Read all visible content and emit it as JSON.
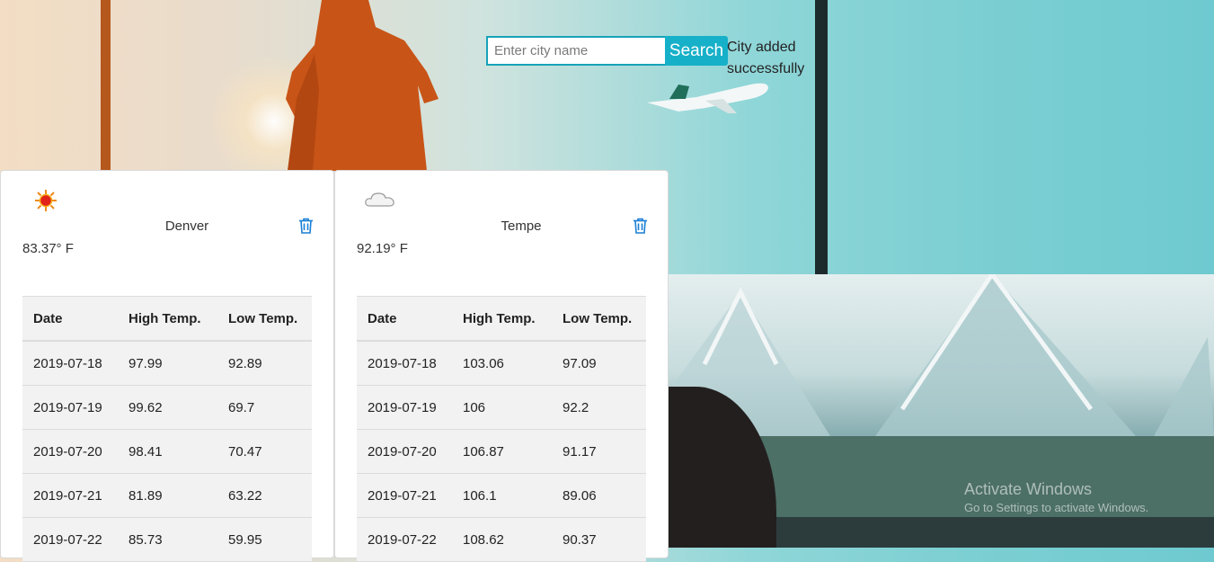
{
  "search": {
    "placeholder": "Enter city name",
    "value": "",
    "button_label": "Search"
  },
  "status_message": "City added successfully",
  "cards": [
    {
      "city": "Denver",
      "icon": "sun-icon",
      "current_temp": "83.37° F",
      "headers": [
        "Date",
        "High Temp.",
        "Low Temp."
      ],
      "rows": [
        [
          "2019-07-18",
          "97.99",
          "92.89"
        ],
        [
          "2019-07-19",
          "99.62",
          "69.7"
        ],
        [
          "2019-07-20",
          "98.41",
          "70.47"
        ],
        [
          "2019-07-21",
          "81.89",
          "63.22"
        ],
        [
          "2019-07-22",
          "85.73",
          "59.95"
        ]
      ]
    },
    {
      "city": "Tempe",
      "icon": "cloud-icon",
      "current_temp": "92.19° F",
      "headers": [
        "Date",
        "High Temp.",
        "Low Temp."
      ],
      "rows": [
        [
          "2019-07-18",
          "103.06",
          "97.09"
        ],
        [
          "2019-07-19",
          "106",
          "92.2"
        ],
        [
          "2019-07-20",
          "106.87",
          "91.17"
        ],
        [
          "2019-07-21",
          "106.1",
          "89.06"
        ],
        [
          "2019-07-22",
          "108.62",
          "90.37"
        ]
      ]
    }
  ],
  "watermark": {
    "line1": "Activate Windows",
    "line2": "Go to Settings to activate Windows."
  },
  "colors": {
    "accent": "#17b0c9",
    "delete_icon": "#1a7fd6"
  }
}
